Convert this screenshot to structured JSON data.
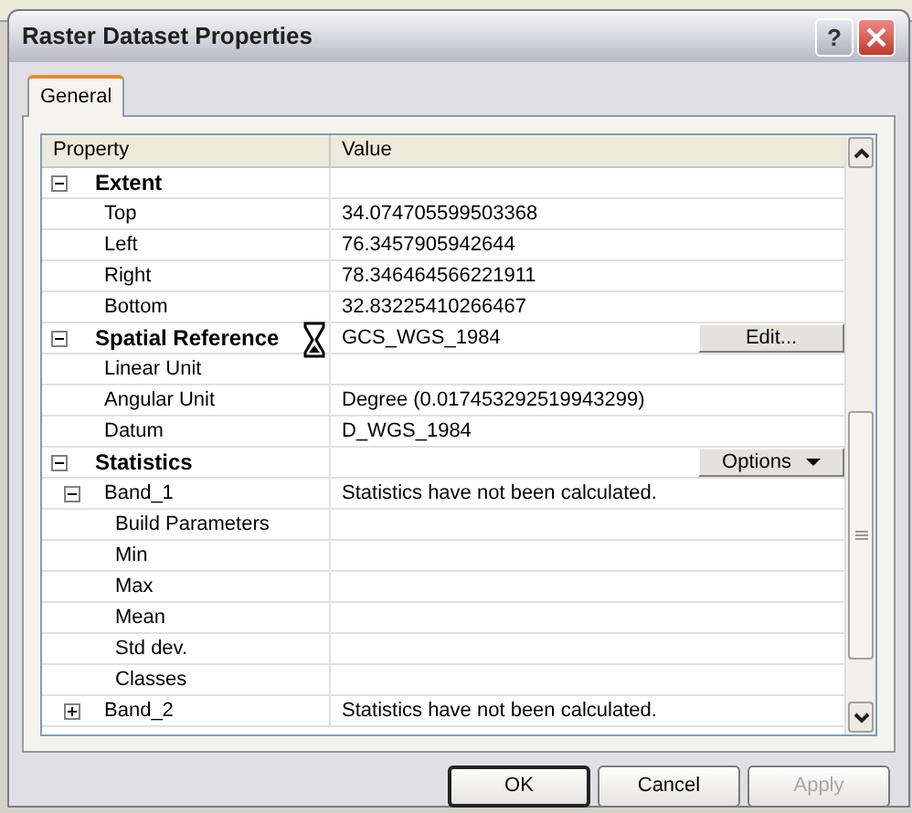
{
  "window": {
    "title": "Raster Dataset Properties"
  },
  "title_buttons": [
    {
      "kind": "help",
      "label": "?"
    },
    {
      "kind": "close"
    }
  ],
  "tabs": [
    {
      "label": "General",
      "selected": true
    }
  ],
  "grid": {
    "columns": [
      "Property",
      "Value"
    ],
    "rows": [
      {
        "label": "Extent",
        "kind": "group",
        "expanded": true,
        "children": [
          {
            "label": "Top",
            "value": "34.074705599503368"
          },
          {
            "label": "Left",
            "value": "76.3457905942644"
          },
          {
            "label": "Right",
            "value": "78.346464566221911"
          },
          {
            "label": "Bottom",
            "value": "32.83225410266467"
          }
        ]
      },
      {
        "label": "Spatial Reference",
        "kind": "group",
        "expanded": true,
        "value": "GCS_WGS_1984",
        "button": {
          "label": "Edit...",
          "dropdown": false
        },
        "children": [
          {
            "label": "Linear Unit"
          },
          {
            "label": "Angular Unit",
            "value": "Degree (0.017453292519943299)"
          },
          {
            "label": "Datum",
            "value": "D_WGS_1984"
          }
        ]
      },
      {
        "label": "Statistics",
        "kind": "group",
        "expanded": true,
        "button": {
          "label": "Options",
          "dropdown": true
        },
        "children": [
          {
            "label": "Band_1",
            "expanded": true,
            "value": "Statistics have not been calculated.",
            "children": [
              {
                "label": "Build Parameters"
              },
              {
                "label": "Min"
              },
              {
                "label": "Max"
              },
              {
                "label": "Mean"
              },
              {
                "label": "Std dev."
              },
              {
                "label": "Classes"
              }
            ]
          },
          {
            "label": "Band_2",
            "expanded": false,
            "value": "Statistics have not been calculated."
          }
        ]
      }
    ]
  },
  "buttons": [
    {
      "label": "OK",
      "default": true,
      "disabled": false
    },
    {
      "label": "Cancel",
      "default": false,
      "disabled": false
    },
    {
      "label": "Apply",
      "default": false,
      "disabled": true
    }
  ]
}
